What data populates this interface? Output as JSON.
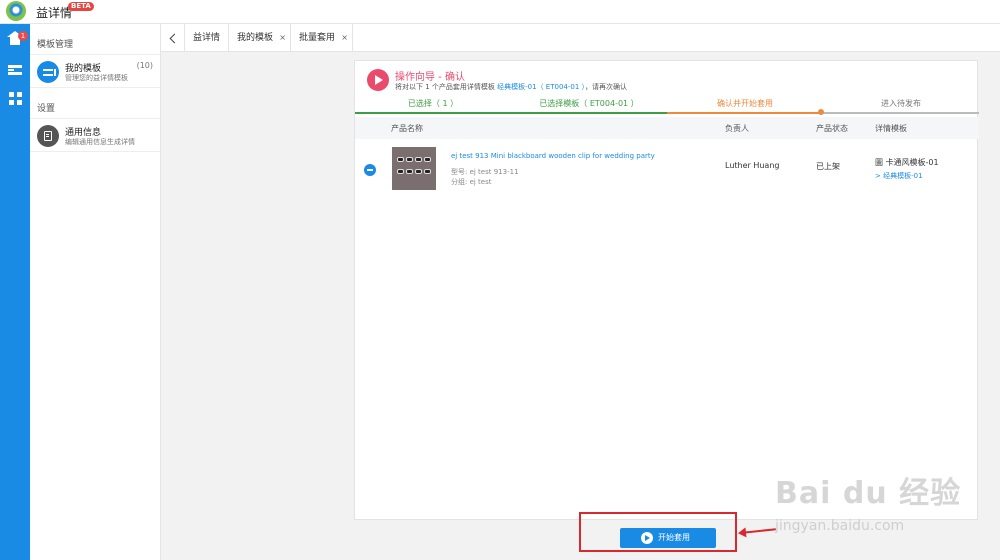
{
  "app": {
    "title": "益详情",
    "badge": "BETA"
  },
  "rail": {
    "home_badge": "1"
  },
  "sidebar": {
    "section_templates": "模板管理",
    "my_templates": {
      "title": "我的模板",
      "subtitle": "管理您的益详情模板",
      "count": "(10)"
    },
    "section_settings": "设置",
    "general_info": {
      "title": "通用信息",
      "subtitle": "编辑通用信息生成详情"
    }
  },
  "tabs": [
    {
      "label": "益详情"
    },
    {
      "label": "我的模板",
      "close": "×"
    },
    {
      "label": "批量套用",
      "close": "×"
    }
  ],
  "wizard": {
    "title": "操作向导 - 确认",
    "desc_prefix": "将对以下 1 个产品套用详情模板 ",
    "desc_link": "经典模板-01（ ET004-01 ）",
    "desc_suffix": "，请再次确认",
    "steps": [
      {
        "label": "已选择（ 1 ）",
        "state": "done"
      },
      {
        "label": "已选择模板（ ET004-01 ）",
        "state": "done"
      },
      {
        "label": "确认并开始套用",
        "state": "current"
      },
      {
        "label": "进入待发布",
        "state": "todo"
      }
    ],
    "colors": {
      "done": "#3c9f43",
      "current": "#ef8a3c",
      "todo": "#888888"
    }
  },
  "table": {
    "headers": {
      "name": "产品名称",
      "owner": "负责人",
      "status": "产品状态",
      "template": "详情模板"
    },
    "rows": [
      {
        "name": "ej test 913 Mini blackboard wooden clip for wedding party",
        "model": "型号: ej test 913-11",
        "group": "分组: ej test",
        "owner": "Luther Huang",
        "status": "已上架",
        "template": "圖 卡通风模板-01",
        "template_link": "> 经典模板-01"
      }
    ]
  },
  "action": {
    "start_label": "开始套用"
  },
  "watermark": {
    "brand": "Bai du 经验",
    "url": "jingyan.baidu.com"
  },
  "accent": "#1a8be5"
}
